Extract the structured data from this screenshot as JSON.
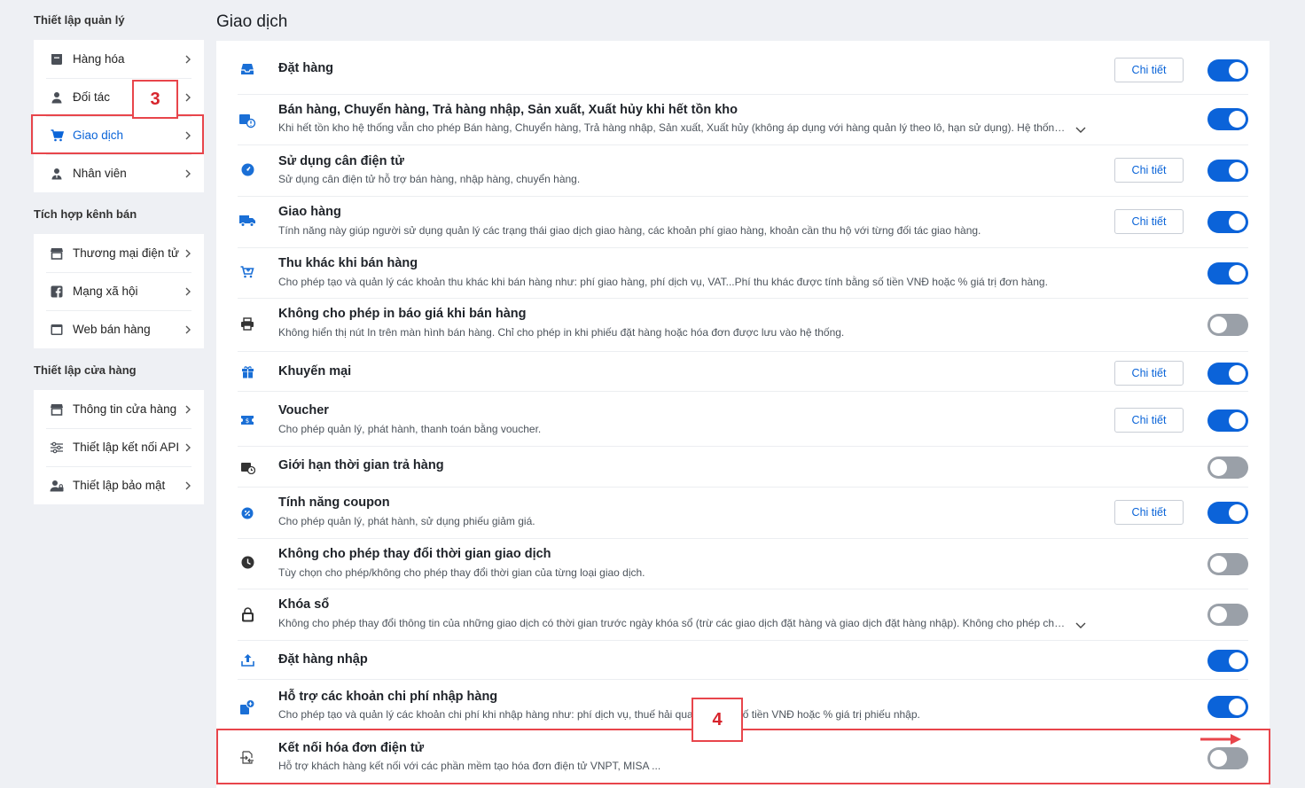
{
  "sidebar": {
    "sections": [
      {
        "title": "Thiết lập quản lý",
        "items": [
          {
            "label": "Hàng hóa",
            "icon": "box-icon"
          },
          {
            "label": "Đối tác",
            "icon": "user-icon"
          },
          {
            "label": "Giao dịch",
            "icon": "cart-icon",
            "active": true
          },
          {
            "label": "Nhân viên",
            "icon": "staff-icon"
          }
        ]
      },
      {
        "title": "Tích hợp kênh bán",
        "items": [
          {
            "label": "Thương mại điện tử",
            "icon": "store-icon"
          },
          {
            "label": "Mạng xã hội",
            "icon": "facebook-icon"
          },
          {
            "label": "Web bán hàng",
            "icon": "web-icon"
          }
        ]
      },
      {
        "title": "Thiết lập cửa hàng",
        "items": [
          {
            "label": "Thông tin cửa hàng",
            "icon": "store-info-icon"
          },
          {
            "label": "Thiết lập kết nối API",
            "icon": "sliders-icon"
          },
          {
            "label": "Thiết lập bảo mật",
            "icon": "security-user-icon"
          }
        ]
      }
    ]
  },
  "main": {
    "title": "Giao dịch",
    "detail_label": "Chi tiết",
    "settings": [
      {
        "title": "Đặt hàng",
        "desc": "",
        "detail": true,
        "enabled": true,
        "icon": "inbox-icon"
      },
      {
        "title": "Bán hàng, Chuyển hàng, Trả hàng nhập, Sản xuất, Xuất hủy khi hết tồn kho",
        "desc": "Khi hết tồn kho hệ thống vẫn cho phép Bán hàng, Chuyển hàng, Trả hàng nhập, Sản xuất, Xuất hủy (không áp dụng với hàng quản lý theo lô, hạn sử dụng). Hệ thống sẽ…",
        "detail": false,
        "enabled": true,
        "expandable": true,
        "icon": "stock-alert-icon"
      },
      {
        "title": "Sử dụng cân điện tử",
        "desc": "Sử dụng cân điện tử hỗ trợ bán hàng, nhập hàng, chuyển hàng.",
        "detail": true,
        "enabled": true,
        "icon": "scale-icon"
      },
      {
        "title": "Giao hàng",
        "desc": "Tính năng này giúp người sử dụng quản lý các trạng thái giao dịch giao hàng, các khoản phí giao hàng, khoản cần thu hộ với từng đối tác giao hàng.",
        "detail": true,
        "enabled": true,
        "icon": "truck-icon"
      },
      {
        "title": "Thu khác khi bán hàng",
        "desc": "Cho phép tạo và quản lý các khoản thu khác khi bán hàng như: phí giao hàng, phí dịch vụ, VAT...Phí thu khác được tính bằng số tiền VNĐ hoặc % giá trị đơn hàng.",
        "detail": false,
        "enabled": true,
        "icon": "cart-plus-icon"
      },
      {
        "title": "Không cho phép in báo giá khi bán hàng",
        "desc": "Không hiển thị nút In trên màn hình bán hàng. Chỉ cho phép in khi phiếu đặt hàng hoặc hóa đơn được lưu vào hệ thống.",
        "detail": false,
        "enabled": false,
        "icon": "printer-icon"
      },
      {
        "title": "Khuyến mại",
        "desc": "",
        "detail": true,
        "enabled": true,
        "icon": "gift-icon"
      },
      {
        "title": "Voucher",
        "desc": "Cho phép quản lý, phát hành, thanh toán bằng voucher.",
        "detail": true,
        "enabled": true,
        "icon": "voucher-icon"
      },
      {
        "title": "Giới hạn thời gian trả hàng",
        "desc": "",
        "detail": false,
        "enabled": false,
        "icon": "return-time-icon"
      },
      {
        "title": "Tính năng coupon",
        "desc": "Cho phép quản lý, phát hành, sử dụng phiếu giảm giá.",
        "detail": true,
        "enabled": true,
        "icon": "coupon-icon"
      },
      {
        "title": "Không cho phép thay đổi thời gian giao dịch",
        "desc": "Tùy chọn cho phép/không cho phép thay đổi thời gian của từng loại giao dịch.",
        "detail": false,
        "enabled": false,
        "icon": "clock-icon"
      },
      {
        "title": "Khóa sổ",
        "desc": "Không cho phép thay đổi thông tin của những giao dịch có thời gian trước ngày khóa sổ (trừ các giao dịch đặt hàng và giao dịch đặt hàng nhập). Không cho phép chuyể…",
        "detail": false,
        "enabled": false,
        "expandable": true,
        "icon": "lock-icon"
      },
      {
        "title": "Đặt hàng nhập",
        "desc": "",
        "detail": false,
        "enabled": true,
        "icon": "upload-icon"
      },
      {
        "title": "Hỗ trợ các khoản chi phí nhập hàng",
        "desc": "Cho phép tạo và quản lý các khoản chi phí khi nhập hàng như: phí dịch vụ, thuế hải quan...                  bằng số tiền VNĐ hoặc % giá trị phiếu nhập.",
        "detail": false,
        "enabled": true,
        "icon": "import-cost-icon"
      },
      {
        "title": "Kết nối hóa đơn điện tử",
        "desc": "Hỗ trợ khách hàng kết nối với các phần mềm tạo hóa đơn điện tử VNPT, MISA ...",
        "detail": false,
        "enabled": false,
        "icon": "e-invoice-icon"
      }
    ]
  },
  "annotations": {
    "step3": "3",
    "step4": "4"
  },
  "colors": {
    "accent": "#0b63d9",
    "toggle_off": "#9aa0a8",
    "annotation": "#e8454b"
  }
}
